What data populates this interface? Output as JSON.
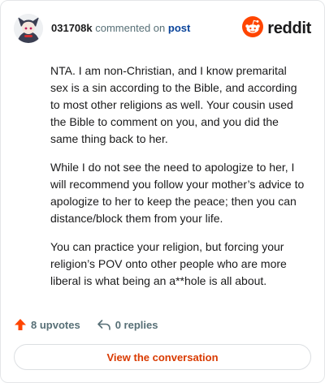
{
  "comment": {
    "username": "031708k",
    "action_text": "commented on",
    "post_link_label": "post",
    "avatar_icon": "user-avatar-icon",
    "body_paragraphs": [
      "NTA. I am non-Christian, and I know premarital sex is a sin according to the Bible, and according to most other religions as well. Your cousin used the Bible to comment on you, and you did the same thing back to her.",
      "While I do not see the need to apologize to her, I will recommend you follow your mother’s advice to apologize to her to keep the peace; then you can distance/block them from your life.",
      "You can practice your religion, but forcing your religion’s POV onto other people who are more liberal is what being an a**hole is all about."
    ]
  },
  "brand": {
    "wordmark": "reddit",
    "icon": "reddit-logo-icon",
    "accent_color": "#ff4500"
  },
  "footer": {
    "upvotes_label": "8 upvotes",
    "replies_label": "0 replies",
    "upvote_icon": "upvote-arrow-icon",
    "reply_icon": "reply-arrow-icon"
  },
  "cta": {
    "label": "View the conversation",
    "color": "#d93a00"
  }
}
